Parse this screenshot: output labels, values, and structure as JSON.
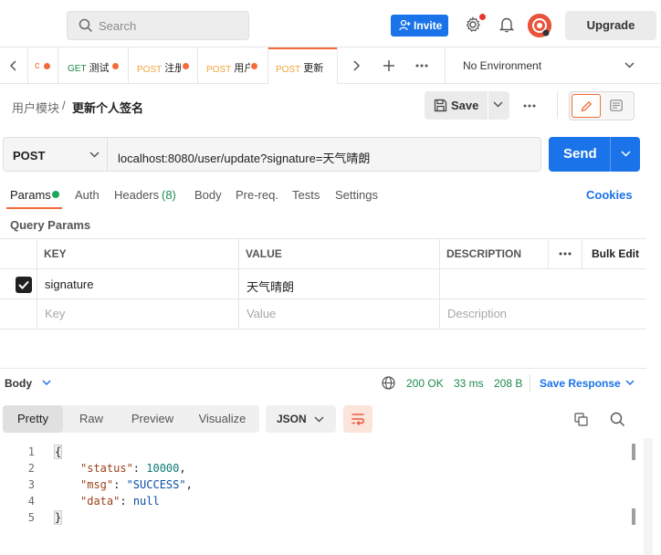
{
  "header": {
    "search_placeholder": "Search",
    "invite_label": "Invite",
    "upgrade_label": "Upgrade"
  },
  "tabs": [
    {
      "method": "",
      "title": "c",
      "method_color": "#f26b3a"
    },
    {
      "method": "GET",
      "title": "测试",
      "method_color": "#1d8a4f"
    },
    {
      "method": "POST",
      "title": "注册",
      "method_color": "#f0a33b"
    },
    {
      "method": "POST",
      "title": "用户",
      "method_color": "#f0a33b"
    },
    {
      "method": "POST",
      "title": "更新",
      "method_color": "#f0a33b"
    }
  ],
  "environment": "No Environment",
  "breadcrumb": {
    "parent": "用户模块",
    "separator": "/",
    "current": "更新个人签名"
  },
  "toolbar": {
    "save_label": "Save"
  },
  "request": {
    "method": "POST",
    "url": "localhost:8080/user/update?signature=天气晴朗",
    "send_label": "Send"
  },
  "request_tabs": {
    "params": "Params",
    "auth": "Auth",
    "headers": "Headers",
    "headers_count": "(8)",
    "body": "Body",
    "prereq": "Pre-req.",
    "tests": "Tests",
    "settings": "Settings",
    "cookies": "Cookies"
  },
  "query_params": {
    "title": "Query Params",
    "columns": {
      "key": "KEY",
      "value": "VALUE",
      "description": "DESCRIPTION",
      "bulk_edit": "Bulk Edit"
    },
    "rows": [
      {
        "key": "signature",
        "value": "天气晴朗",
        "description": "",
        "checked": true
      }
    ],
    "placeholders": {
      "key": "Key",
      "value": "Value",
      "description": "Description"
    }
  },
  "response": {
    "body_label": "Body",
    "status": "200 OK",
    "time": "33 ms",
    "size": "208 B",
    "save_response": "Save Response",
    "view_tabs": [
      "Pretty",
      "Raw",
      "Preview",
      "Visualize"
    ],
    "format": "JSON",
    "lines": [
      {
        "num": "1",
        "text": "{"
      },
      {
        "num": "2",
        "key": "\"status\"",
        "value": "10000"
      },
      {
        "num": "3",
        "key": "\"msg\"",
        "value": "\"SUCCESS\""
      },
      {
        "num": "4",
        "key": "\"data\"",
        "value": "null"
      },
      {
        "num": "5",
        "text": "}"
      }
    ]
  },
  "colors": {
    "accent": "#f26b3a",
    "primary": "#1a73e8",
    "success": "#1d8a4f"
  }
}
